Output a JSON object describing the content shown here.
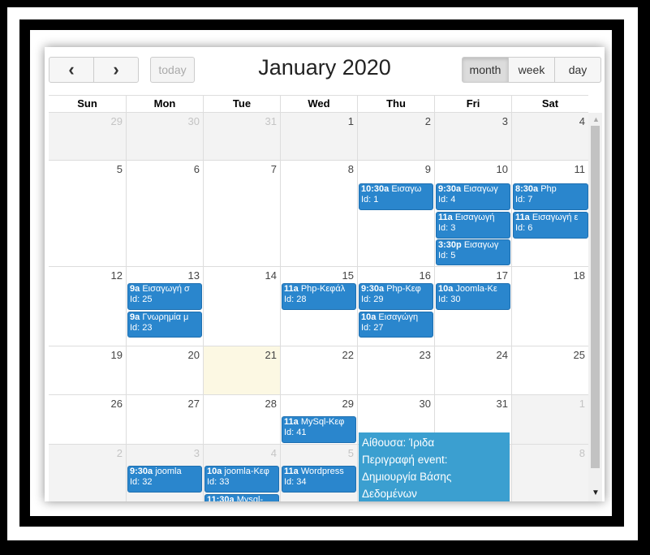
{
  "toolbar": {
    "prev_icon": "‹",
    "next_icon": "›",
    "today_label": "today",
    "title": "January 2020",
    "views": [
      "month",
      "week",
      "day"
    ],
    "active_view": "month"
  },
  "day_headers": [
    "Sun",
    "Mon",
    "Tue",
    "Wed",
    "Thu",
    "Fri",
    "Sat"
  ],
  "weeks": [
    [
      "29",
      "30",
      "31",
      "1",
      "2",
      "3",
      "4"
    ],
    [
      "5",
      "6",
      "7",
      "8",
      "9",
      "10",
      "11"
    ],
    [
      "12",
      "13",
      "14",
      "15",
      "16",
      "17",
      "18"
    ],
    [
      "19",
      "20",
      "21",
      "22",
      "23",
      "24",
      "25"
    ],
    [
      "26",
      "27",
      "28",
      "29",
      "30",
      "31",
      "1"
    ],
    [
      "2",
      "3",
      "4",
      "5",
      "6",
      "7",
      "8"
    ]
  ],
  "events": {
    "thu9_a": {
      "time": "10:30a",
      "title": "Εισαγω",
      "id": "Id: 1"
    },
    "fri10_a": {
      "time": "9:30a",
      "title": "Εισαγωγ",
      "id": "Id: 4"
    },
    "fri10_b": {
      "time": "11a",
      "title": "Εισαγωγή",
      "id": "Id: 3"
    },
    "fri10_c": {
      "time": "3:30p",
      "title": "Εισαγωγ",
      "id": "Id: 5"
    },
    "sat11_a": {
      "time": "8:30a",
      "title": "Php",
      "id": "Id: 7"
    },
    "sat11_b": {
      "time": "11a",
      "title": "Εισαγωγή ε",
      "id": "Id: 6"
    },
    "mon13_a": {
      "time": "9a",
      "title": "Εισαγωγή σ",
      "id": "Id: 25"
    },
    "mon13_b": {
      "time": "9a",
      "title": "Γνωρημία μ",
      "id": "Id: 23"
    },
    "wed15_a": {
      "time": "11a",
      "title": "Php-Κεφάλ",
      "id": "Id: 28"
    },
    "thu16_a": {
      "time": "9:30a",
      "title": "Php-Κεφ",
      "id": "Id: 29"
    },
    "thu16_b": {
      "time": "10a",
      "title": "Εισαγώγη",
      "id": "Id: 27"
    },
    "fri17_a": {
      "time": "10a",
      "title": "Joomla-Κε",
      "id": "Id: 30"
    },
    "wed29_a": {
      "time": "11a",
      "title": "MySql-Κεφ",
      "id": "Id: 41"
    },
    "mon3_a": {
      "time": "9:30a",
      "title": "joomla",
      "id": "Id: 32"
    },
    "tue4_a": {
      "time": "10a",
      "title": "joomla-Κεφ",
      "id": "Id: 33"
    },
    "tue4_b": {
      "time": "11:30a",
      "title": "Mysql-",
      "id": ""
    },
    "wed5_a": {
      "time": "11a",
      "title": "Wordpress",
      "id": "Id: 34"
    }
  },
  "popup": {
    "line1": "Αίθουσα: Ίριδα",
    "line2": "Περιγραφή event:",
    "line3": "Δημιουργία Βάσης",
    "line4": "Δεδομένων"
  },
  "colors": {
    "event_bg": "#2a86cd",
    "popup_bg": "#3b9fd0",
    "today_bg": "#fcf8e3"
  }
}
